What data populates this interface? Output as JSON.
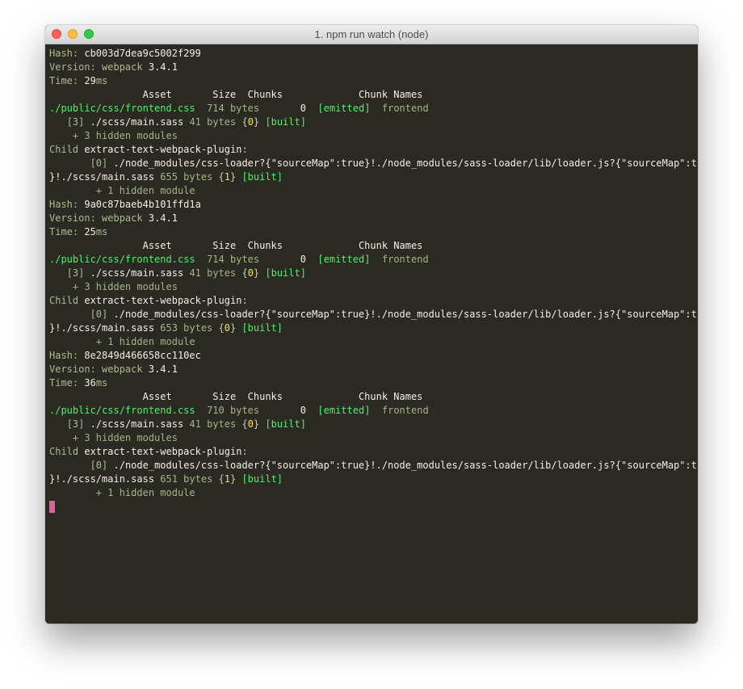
{
  "window": {
    "title": "1. npm run watch (node)"
  },
  "icons": {
    "close": "close-traffic-light-icon",
    "minimize": "minimize-traffic-light-icon",
    "zoom": "zoom-traffic-light-icon"
  },
  "colors": {
    "background": "#2b2a22",
    "green": "#4ff06e",
    "yellow": "#f3e05a",
    "cursor": "#e05f9a"
  },
  "terminal": {
    "builds": [
      {
        "hash_label": "Hash:",
        "hash": "cb003d7dea9c5002f299",
        "version_label": "Version:",
        "version_tool": "webpack",
        "version": "3.4.1",
        "time_label": "Time:",
        "time_value": "29",
        "time_unit": "ms",
        "header_pad": "                ",
        "header": [
          "Asset",
          "Size",
          "Chunks",
          "Chunk Names"
        ],
        "asset": "./public/css/frontend.css",
        "size_num": "714",
        "size_unit": "bytes",
        "chunk": "0",
        "emitted": "[emitted]",
        "chunk_name": "frontend",
        "module_id": "[3]",
        "module_path": "./scss/main.sass",
        "module_size": "41 bytes",
        "module_chunk": "0",
        "built": "[built]",
        "hidden": "+ 3 hidden modules",
        "child_label": "Child",
        "child_name": "extract-text-webpack-plugin",
        "child_module_id": "[0]",
        "child_module_path1": "./node_modules/css-loader?{\"sourceMap\":true}!./node_modules/sass-loader/lib/loader.js?{\"sourceMap\":true",
        "child_module_path2": "}!./scss/main.sass",
        "child_size": "655 bytes",
        "child_chunk": "1",
        "child_built": "[built]",
        "child_hidden": "+ 1 hidden module"
      },
      {
        "hash_label": "Hash:",
        "hash": "9a0c87baeb4b101ffd1a",
        "version_label": "Version:",
        "version_tool": "webpack",
        "version": "3.4.1",
        "time_label": "Time:",
        "time_value": "25",
        "time_unit": "ms",
        "header_pad": "                ",
        "header": [
          "Asset",
          "Size",
          "Chunks",
          "Chunk Names"
        ],
        "asset": "./public/css/frontend.css",
        "size_num": "714",
        "size_unit": "bytes",
        "chunk": "0",
        "emitted": "[emitted]",
        "chunk_name": "frontend",
        "module_id": "[3]",
        "module_path": "./scss/main.sass",
        "module_size": "41 bytes",
        "module_chunk": "0",
        "built": "[built]",
        "hidden": "+ 3 hidden modules",
        "child_label": "Child",
        "child_name": "extract-text-webpack-plugin",
        "child_module_id": "[0]",
        "child_module_path1": "./node_modules/css-loader?{\"sourceMap\":true}!./node_modules/sass-loader/lib/loader.js?{\"sourceMap\":true",
        "child_module_path2": "}!./scss/main.sass",
        "child_size": "653 bytes",
        "child_chunk": "0",
        "child_built": "[built]",
        "child_hidden": "+ 1 hidden module"
      },
      {
        "hash_label": "Hash:",
        "hash": "8e2849d466658cc110ec",
        "version_label": "Version:",
        "version_tool": "webpack",
        "version": "3.4.1",
        "time_label": "Time:",
        "time_value": "36",
        "time_unit": "ms",
        "header_pad": "                ",
        "header": [
          "Asset",
          "Size",
          "Chunks",
          "Chunk Names"
        ],
        "asset": "./public/css/frontend.css",
        "size_num": "710",
        "size_unit": "bytes",
        "chunk": "0",
        "emitted": "[emitted]",
        "chunk_name": "frontend",
        "module_id": "[3]",
        "module_path": "./scss/main.sass",
        "module_size": "41 bytes",
        "module_chunk": "0",
        "built": "[built]",
        "hidden": "+ 3 hidden modules",
        "child_label": "Child",
        "child_name": "extract-text-webpack-plugin",
        "child_module_id": "[0]",
        "child_module_path1": "./node_modules/css-loader?{\"sourceMap\":true}!./node_modules/sass-loader/lib/loader.js?{\"sourceMap\":true",
        "child_module_path2": "}!./scss/main.sass",
        "child_size": "651 bytes",
        "child_chunk": "1",
        "child_built": "[built]",
        "child_hidden": "+ 1 hidden module"
      }
    ]
  }
}
